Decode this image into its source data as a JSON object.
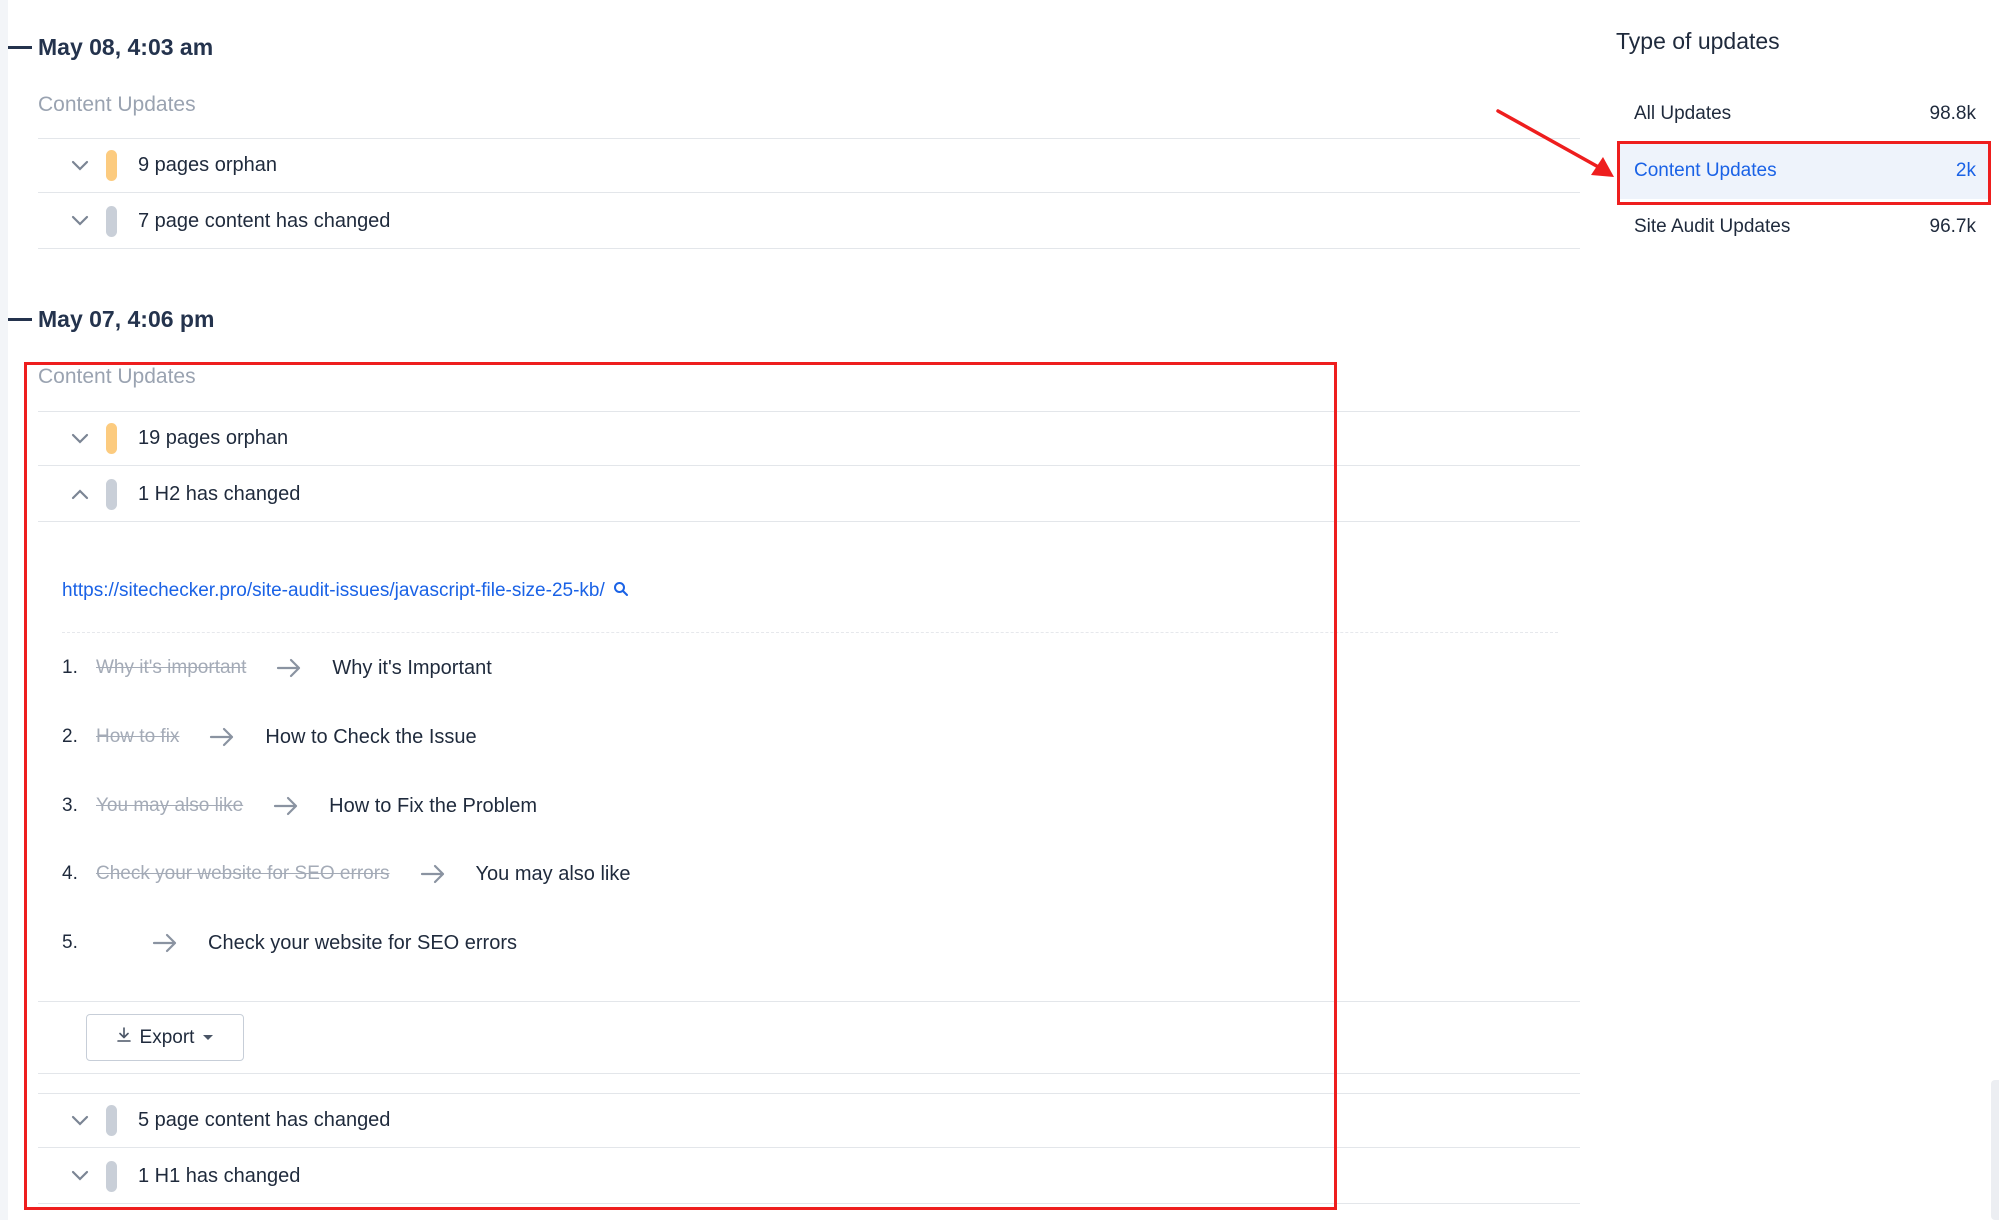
{
  "timeline": {
    "groups": [
      {
        "date": "May 08, 4:03 am",
        "category": "Content Updates",
        "rows": [
          {
            "text": "9 pages orphan",
            "status": "orange"
          },
          {
            "text": "7 page content has changed",
            "status": "grey"
          }
        ]
      },
      {
        "date": "May 07, 4:06 pm",
        "category": "Content Updates",
        "rows": [
          {
            "text": "19 pages orphan",
            "status": "orange"
          },
          {
            "text": "1 H2 has changed",
            "status": "grey",
            "expanded": true
          },
          {
            "text": "5 page content has changed",
            "status": "grey"
          },
          {
            "text": "1 H1 has changed",
            "status": "grey"
          }
        ],
        "expanded_detail": {
          "url": "https://sitechecker.pro/site-audit-issues/javascript-file-size-25-kb/",
          "changes": [
            {
              "num": "1.",
              "old": "Why it's important",
              "new": "Why it's Important"
            },
            {
              "num": "2.",
              "old": "How to fix",
              "new": "How to Check the Issue"
            },
            {
              "num": "3.",
              "old": "You may also like",
              "new": "How to Fix the Problem"
            },
            {
              "num": "4.",
              "old": "Check your website for SEO errors",
              "new": "You may also like"
            },
            {
              "num": "5.",
              "old": "",
              "new": "Check your website for SEO errors"
            }
          ],
          "export_label": "Export"
        }
      }
    ]
  },
  "sidebar": {
    "title": "Type of updates",
    "items": [
      {
        "label": "All Updates",
        "count": "98.8k"
      },
      {
        "label": "Content Updates",
        "count": "2k",
        "active": true
      },
      {
        "label": "Site Audit Updates",
        "count": "96.7k"
      }
    ]
  },
  "colors": {
    "accent": "#1a62e6",
    "annotation": "#ee1e1e",
    "status_orange": "#fccb7f",
    "status_grey": "#c9cfd8",
    "heading": "#24334d"
  },
  "icons": {
    "collapse": "minus-dash-icon",
    "chevron_down": "chevron-down-icon",
    "chevron_up": "chevron-up-icon",
    "search": "search-icon",
    "arrow_right": "arrow-right-icon",
    "download": "download-icon",
    "caret": "caret-down-icon"
  }
}
